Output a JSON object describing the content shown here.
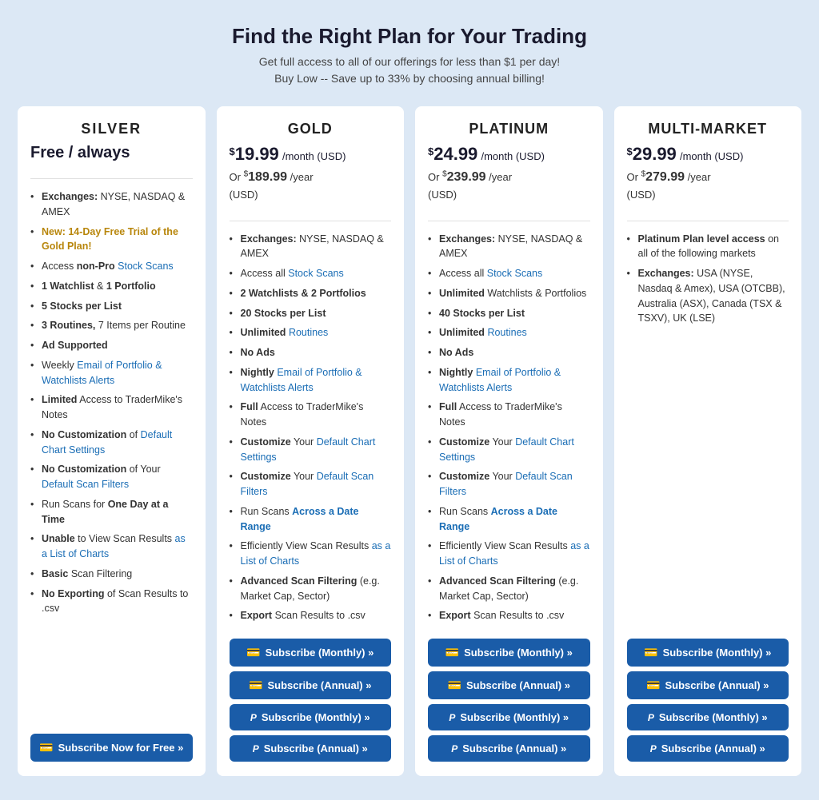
{
  "header": {
    "title": "Find the Right Plan for Your Trading",
    "subtitle_line1": "Get full access to all of our offerings for less than $1 per day!",
    "subtitle_line2": "Buy Low -- Save up to 33% by choosing annual billing!"
  },
  "plans": [
    {
      "id": "silver",
      "name": "SILVER",
      "free_label": "Free / always",
      "monthly_price": null,
      "annual_price": null,
      "features": [
        {
          "text": "Exchanges: NYSE, NASDAQ & AMEX",
          "bold_prefix": "Exchanges:"
        },
        {
          "text": "New: 14-Day Free Trial of the Gold Plan!",
          "gold": true,
          "bold_prefix": "New:"
        },
        {
          "text": "Access non-Pro Stock Scans",
          "link": "Stock Scans",
          "bold_prefix": ""
        },
        {
          "text": "1 Watchlist & 1 Portfolio",
          "bold_prefix": "1 Watchlist"
        },
        {
          "text": "5 Stocks per List",
          "bold_prefix": "5 Stocks per List"
        },
        {
          "text": "3 Routines, 7 Items per Routine",
          "bold_prefix": "3 Routines,"
        },
        {
          "text": "Ad Supported",
          "bold_prefix": "Ad Supported"
        },
        {
          "text": "Weekly Email of Portfolio & Watchlists Alerts",
          "link": "Email of Portfolio & Watchlists Alerts",
          "bold_prefix": "Weekly"
        },
        {
          "text": "Limited Access to TraderMike's Notes",
          "bold_prefix": "Limited"
        },
        {
          "text": "No Customization of Default Chart Settings",
          "link": "Default Chart Settings",
          "bold_prefix": "No Customization"
        },
        {
          "text": "No Customization of Your Default Scan Filters",
          "link": "Default Scan Filters",
          "bold_prefix": "No Customization"
        },
        {
          "text": "Run Scans for One Day at a Time",
          "bold_prefix": "One Day at a Time"
        },
        {
          "text": "Unable to View Scan Results as a List of Charts",
          "link": "as a List of Charts",
          "bold_prefix": "Unable"
        },
        {
          "text": "Basic Scan Filtering",
          "bold_prefix": "Basic"
        },
        {
          "text": "No Exporting of Scan Results to .csv",
          "bold_prefix": "No Exporting"
        }
      ],
      "buttons": [
        {
          "label": "Subscribe Now for Free »",
          "icon": "💳",
          "type": "card"
        }
      ]
    },
    {
      "id": "gold",
      "name": "GOLD",
      "monthly_price": "19.99",
      "monthly_label": "/month (USD)",
      "annual_or": "Or $",
      "annual_price": "189.99",
      "annual_label": "/year (USD)",
      "features": [
        {
          "text": "Exchanges: NYSE, NASDAQ & AMEX",
          "bold_prefix": "Exchanges:"
        },
        {
          "text": "Access all Stock Scans",
          "link": "Stock Scans",
          "bold_prefix": ""
        },
        {
          "text": "2 Watchlists & 2 Portfolios",
          "bold_prefix": "2 Watchlists"
        },
        {
          "text": "20 Stocks per List",
          "bold_prefix": "20 Stocks per List"
        },
        {
          "text": "Unlimited Routines",
          "link": "Routines",
          "bold_prefix": "Unlimited"
        },
        {
          "text": "No Ads",
          "bold_prefix": "No Ads"
        },
        {
          "text": "Nightly Email of Portfolio & Watchlists Alerts",
          "link": "Email of Portfolio & Watchlists Alerts",
          "bold_prefix": "Nightly"
        },
        {
          "text": "Full Access to TraderMike's Notes",
          "bold_prefix": "Full"
        },
        {
          "text": "Customize Your Default Chart Settings",
          "link": "Default Chart Settings",
          "bold_prefix": "Customize"
        },
        {
          "text": "Customize Your Default Scan Filters",
          "link": "Default Scan Filters",
          "bold_prefix": "Customize"
        },
        {
          "text": "Run Scans Across a Date Range",
          "link": "Across a Date Range",
          "bold_prefix": "Run Scans"
        },
        {
          "text": "Efficiently View Scan Results as a List of Charts",
          "link": "as a List of Charts",
          "bold_prefix": "Efficiently"
        },
        {
          "text": "Advanced Scan Filtering (e.g. Market Cap, Sector)",
          "bold_prefix": "Advanced Scan Filtering"
        },
        {
          "text": "Export Scan Results to .csv",
          "bold_prefix": "Export"
        }
      ],
      "buttons": [
        {
          "label": "Subscribe (Monthly) »",
          "icon": "💳",
          "type": "card"
        },
        {
          "label": "Subscribe (Annual) »",
          "icon": "💳",
          "type": "card"
        },
        {
          "label": "Subscribe (Monthly) »",
          "icon": "P",
          "type": "paypal"
        },
        {
          "label": "Subscribe (Annual) »",
          "icon": "P",
          "type": "paypal"
        }
      ]
    },
    {
      "id": "platinum",
      "name": "PLATINUM",
      "monthly_price": "24.99",
      "monthly_label": "/month (USD)",
      "annual_or": "Or $",
      "annual_price": "239.99",
      "annual_label": "/year (USD)",
      "features": [
        {
          "text": "Exchanges: NYSE, NASDAQ & AMEX",
          "bold_prefix": "Exchanges:"
        },
        {
          "text": "Access all Stock Scans",
          "link": "Stock Scans",
          "bold_prefix": ""
        },
        {
          "text": "Unlimited Watchlists & Portfolios",
          "bold_prefix": "Unlimited"
        },
        {
          "text": "40 Stocks per List",
          "bold_prefix": "40 Stocks per List"
        },
        {
          "text": "Unlimited Routines",
          "link": "Routines",
          "bold_prefix": "Unlimited"
        },
        {
          "text": "No Ads",
          "bold_prefix": "No Ads"
        },
        {
          "text": "Nightly Email of Portfolio & Watchlists Alerts",
          "link": "Email of Portfolio & Watchlists Alerts",
          "bold_prefix": "Nightly"
        },
        {
          "text": "Full Access to TraderMike's Notes",
          "bold_prefix": "Full"
        },
        {
          "text": "Customize Your Default Chart Settings",
          "link": "Default Chart Settings",
          "bold_prefix": "Customize"
        },
        {
          "text": "Customize Your Default Scan Filters",
          "link": "Default Scan Filters",
          "bold_prefix": "Customize"
        },
        {
          "text": "Run Scans Across a Date Range",
          "link": "Across a Date Range",
          "bold_prefix": "Run Scans"
        },
        {
          "text": "Efficiently View Scan Results as a List of Charts",
          "link": "as a List of Charts",
          "bold_prefix": "Efficiently"
        },
        {
          "text": "Advanced Scan Filtering (e.g. Market Cap, Sector)",
          "bold_prefix": "Advanced Scan Filtering"
        },
        {
          "text": "Export Scan Results to .csv",
          "bold_prefix": "Export"
        }
      ],
      "buttons": [
        {
          "label": "Subscribe (Monthly) »",
          "icon": "💳",
          "type": "card"
        },
        {
          "label": "Subscribe (Annual) »",
          "icon": "💳",
          "type": "card"
        },
        {
          "label": "Subscribe (Monthly) »",
          "icon": "P",
          "type": "paypal"
        },
        {
          "label": "Subscribe (Annual) »",
          "icon": "P",
          "type": "paypal"
        }
      ]
    },
    {
      "id": "multimarket",
      "name": "MULTI-MARKET",
      "monthly_price": "29.99",
      "monthly_label": "/month (USD)",
      "annual_or": "Or $",
      "annual_price": "279.99",
      "annual_label": "/year (USD)",
      "features": [
        {
          "text": "Platinum Plan level access on all of the following markets",
          "bold_prefix": "Platinum Plan level access"
        },
        {
          "text": "Exchanges: USA (NYSE, Nasdaq & Amex), USA (OTCBB), Australia (ASX), Canada (TSX & TSXV), UK (LSE)",
          "bold_prefix": "Exchanges:"
        }
      ],
      "buttons": [
        {
          "label": "Subscribe (Monthly) »",
          "icon": "💳",
          "type": "card"
        },
        {
          "label": "Subscribe (Annual) »",
          "icon": "💳",
          "type": "card"
        },
        {
          "label": "Subscribe (Monthly) »",
          "icon": "P",
          "type": "paypal"
        },
        {
          "label": "Subscribe (Annual) »",
          "icon": "P",
          "type": "paypal"
        }
      ]
    }
  ]
}
